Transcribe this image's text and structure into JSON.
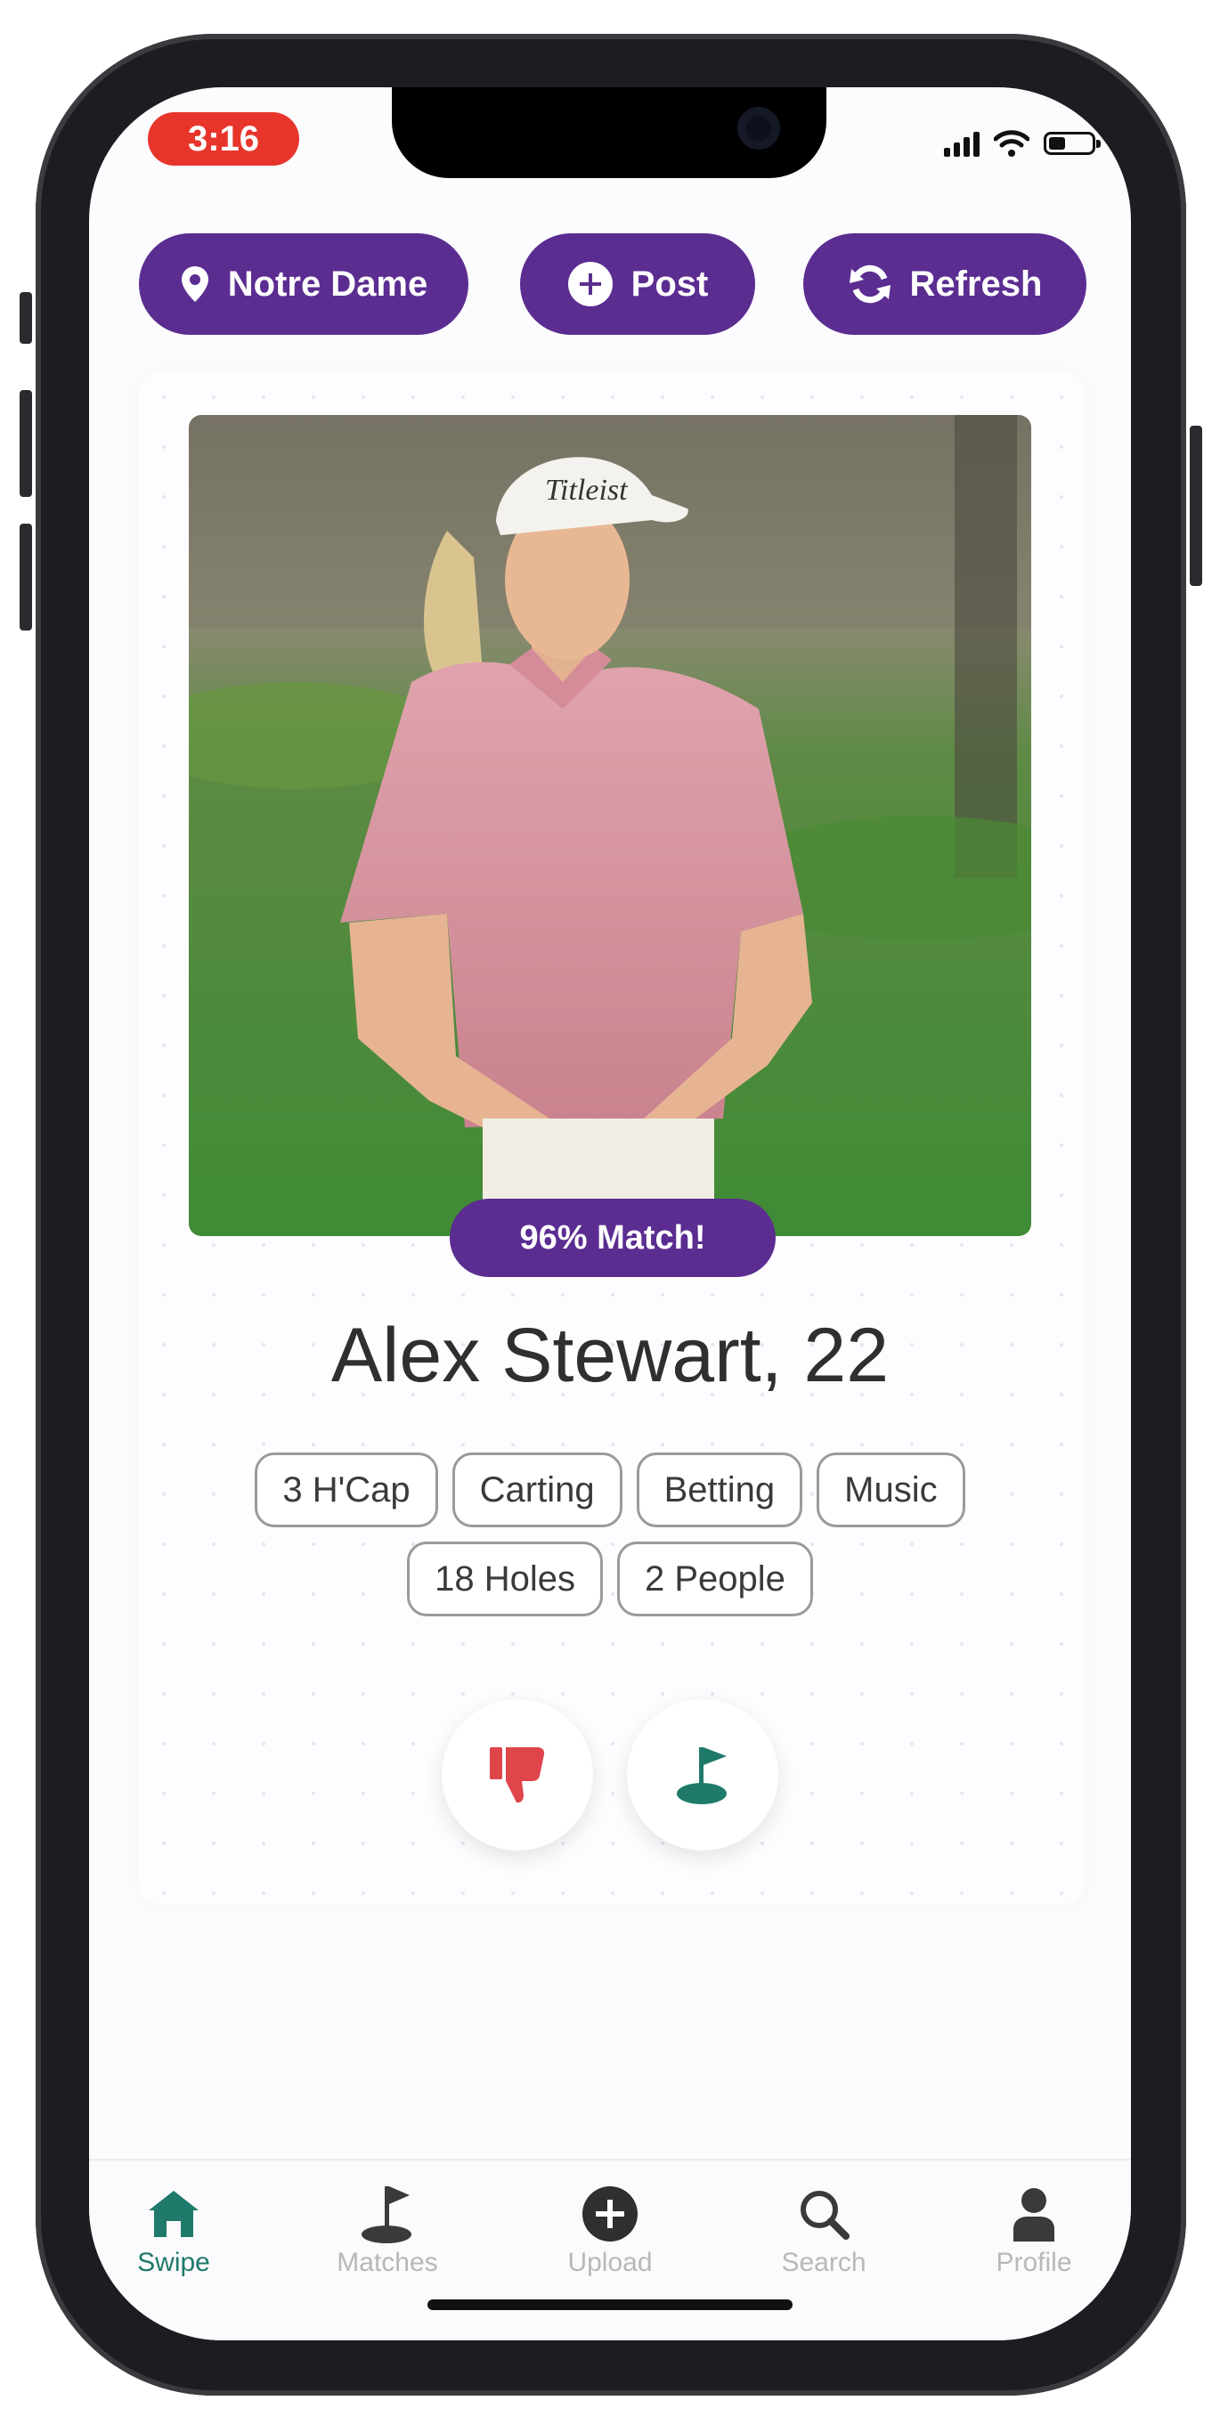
{
  "status_bar": {
    "time": "3:16"
  },
  "header": {
    "location_label": "Notre Dame",
    "post_label": "Post",
    "refresh_label": "Refresh"
  },
  "profile": {
    "match_label": "96% Match!",
    "name_age": "Alex Stewart, 22",
    "tags": [
      "3 H'Cap",
      "Carting",
      "Betting",
      "Music",
      "18 Holes",
      "2 People"
    ]
  },
  "actions": {
    "dislike_icon": "thumbs-down-icon",
    "like_icon": "golf-flag-icon"
  },
  "tab_bar": {
    "items": [
      {
        "label": "Swipe",
        "icon": "home-icon",
        "active": true
      },
      {
        "label": "Matches",
        "icon": "golf-flag-icon",
        "active": false
      },
      {
        "label": "Upload",
        "icon": "plus-circle-icon",
        "active": false
      },
      {
        "label": "Search",
        "icon": "search-icon",
        "active": false
      },
      {
        "label": "Profile",
        "icon": "person-icon",
        "active": false
      }
    ]
  },
  "colors": {
    "primary": "#5b2d91",
    "accent_green": "#1f7a6c",
    "dislike_red": "#e0454b",
    "time_pill": "#e8352b"
  }
}
